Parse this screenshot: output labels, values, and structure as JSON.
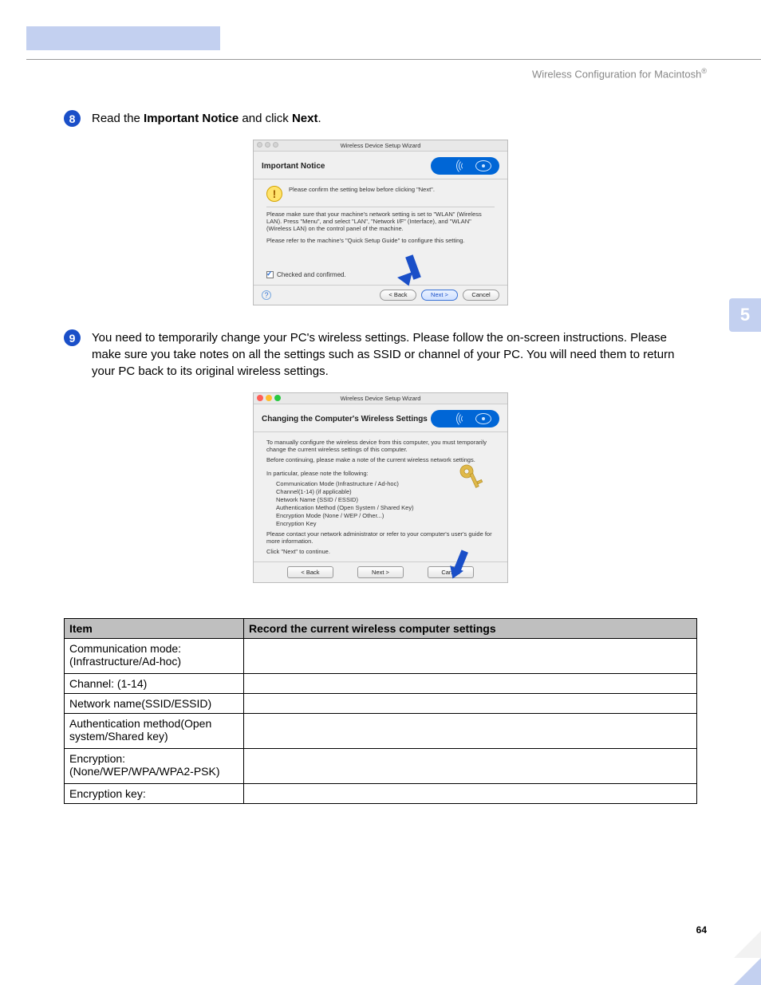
{
  "header": {
    "title_prefix": "Wireless Configuration for Macintosh",
    "title_suffix": "®"
  },
  "side_tab": "5",
  "page_number": "64",
  "steps": {
    "s8": {
      "num": "8",
      "t1": "Read the ",
      "b1": "Important Notice",
      "t2": " and click ",
      "b2": "Next",
      "t3": "."
    },
    "s9": {
      "num": "9",
      "text": "You need to temporarily change your PC's wireless settings. Please follow the on-screen instructions. Please make sure you take notes on all the settings such as SSID or channel of your PC. You will need them to return your PC back to its original wireless settings."
    }
  },
  "wizard1": {
    "window_title": "Wireless Device Setup Wizard",
    "header": "Important Notice",
    "line1": "Please confirm the setting below before clicking \"Next\".",
    "para1": "Please make sure that your machine's network setting is set to \"WLAN\" (Wireless LAN). Press \"Menu\", and select \"LAN\", \"Network I/F\" (Interface), and \"WLAN\" (Wireless LAN) on the control panel of the machine.",
    "para2": "Please refer to the machine's \"Quick Setup Guide\" to configure this setting.",
    "checkbox": "Checked and confirmed.",
    "btn_back": "< Back",
    "btn_next": "Next >",
    "btn_cancel": "Cancel"
  },
  "wizard2": {
    "window_title": "Wireless Device Setup Wizard",
    "header": "Changing the Computer's Wireless Settings",
    "p1": "To manually configure the wireless device from this computer, you must temporarily change the current wireless settings of this computer.",
    "p2": "Before continuing, please make a note of the current wireless network settings.",
    "p3": "In particular, please note the following:",
    "list": {
      "i1": "Communication Mode (Infrastructure / Ad-hoc)",
      "i2": "Channel(1-14) (if applicable)",
      "i3": "Network Name (SSID / ESSID)",
      "i4": "Authentication Method (Open System / Shared Key)",
      "i5": "Encryption Mode (None / WEP / Other...)",
      "i6": "Encryption Key"
    },
    "p4": "Please contact your network administrator or refer to your computer's user's guide for more information.",
    "p5": "Click \"Next\" to continue.",
    "btn_back": "< Back",
    "btn_next": "Next >",
    "btn_cancel": "Cancel"
  },
  "table": {
    "h1": "Item",
    "h2": "Record the current wireless computer settings",
    "rows": {
      "r1": "Communication mode:(Infrastructure/Ad-hoc)",
      "r2": "Channel: (1-14)",
      "r3": "Network name(SSID/ESSID)",
      "r4": "Authentication method(Open system/Shared key)",
      "r5": "Encryption:(None/WEP/WPA/WPA2-PSK)",
      "r6": "Encryption key:"
    }
  }
}
